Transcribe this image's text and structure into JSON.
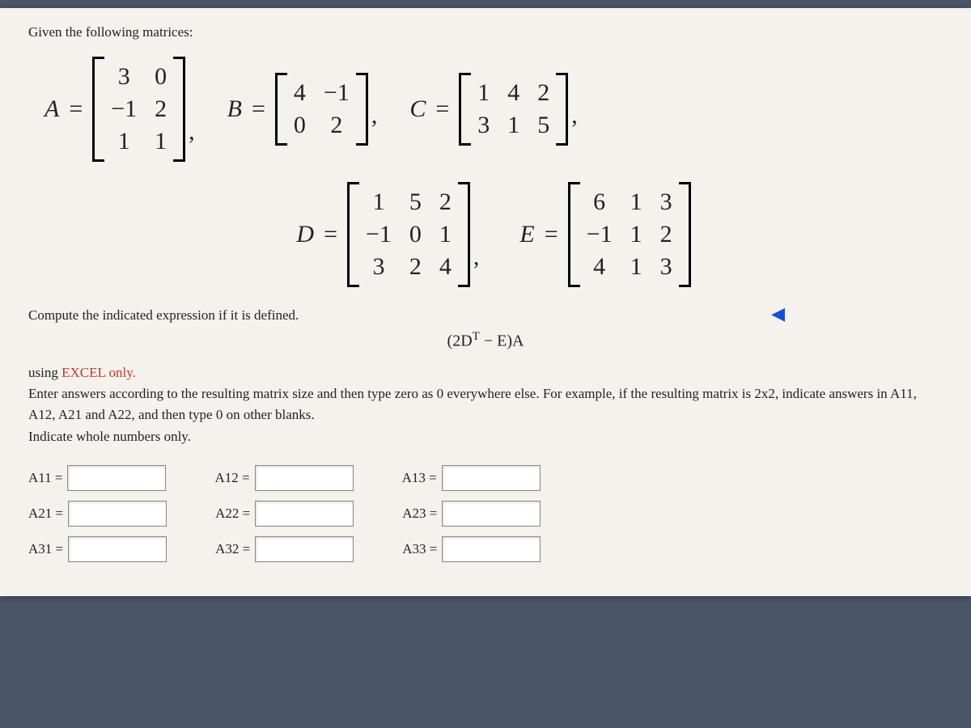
{
  "prompt_intro": "Given the following matrices:",
  "matrices": {
    "A": {
      "name": "A",
      "rows": [
        [
          "3",
          "0"
        ],
        [
          "−1",
          "2"
        ],
        [
          "1",
          "1"
        ]
      ]
    },
    "B": {
      "name": "B",
      "rows": [
        [
          "4",
          "−1"
        ],
        [
          "0",
          "2"
        ]
      ]
    },
    "C": {
      "name": "C",
      "rows": [
        [
          "1",
          "4",
          "2"
        ],
        [
          "3",
          "1",
          "5"
        ]
      ]
    },
    "D": {
      "name": "D",
      "rows": [
        [
          "1",
          "5",
          "2"
        ],
        [
          "−1",
          "0",
          "1"
        ],
        [
          "3",
          "2",
          "4"
        ]
      ]
    },
    "E": {
      "name": "E",
      "rows": [
        [
          "6",
          "1",
          "3"
        ],
        [
          "−1",
          "1",
          "2"
        ],
        [
          "4",
          "1",
          "3"
        ]
      ]
    }
  },
  "eq_symbol": "=",
  "comma": ",",
  "instruction1": "Compute the indicated expression if it is defined.",
  "expression": {
    "pre": "(2D",
    "sup": "T",
    "post": " − E)A"
  },
  "caveats": {
    "line1_pre": "using ",
    "line1_em": "EXCEL only.",
    "line2": "Enter answers according to the resulting matrix size and then type zero as 0 everywhere else. For example, if the resulting matrix is 2x2, indicate answers in A11, A12, A21 and A22, and then type 0 on other blanks.",
    "line3": "Indicate whole numbers only."
  },
  "answers": {
    "labels": {
      "A11": "A11 =",
      "A12": "A12 =",
      "A13": "A13 =",
      "A21": "A21 =",
      "A22": "A22 =",
      "A23": "A23 =",
      "A31": "A31 =",
      "A32": "A32 =",
      "A33": "A33 ="
    },
    "values": {
      "A11": "",
      "A12": "",
      "A13": "",
      "A21": "",
      "A22": "",
      "A23": "",
      "A31": "",
      "A32": "",
      "A33": ""
    }
  },
  "nav_arrow": "◀"
}
